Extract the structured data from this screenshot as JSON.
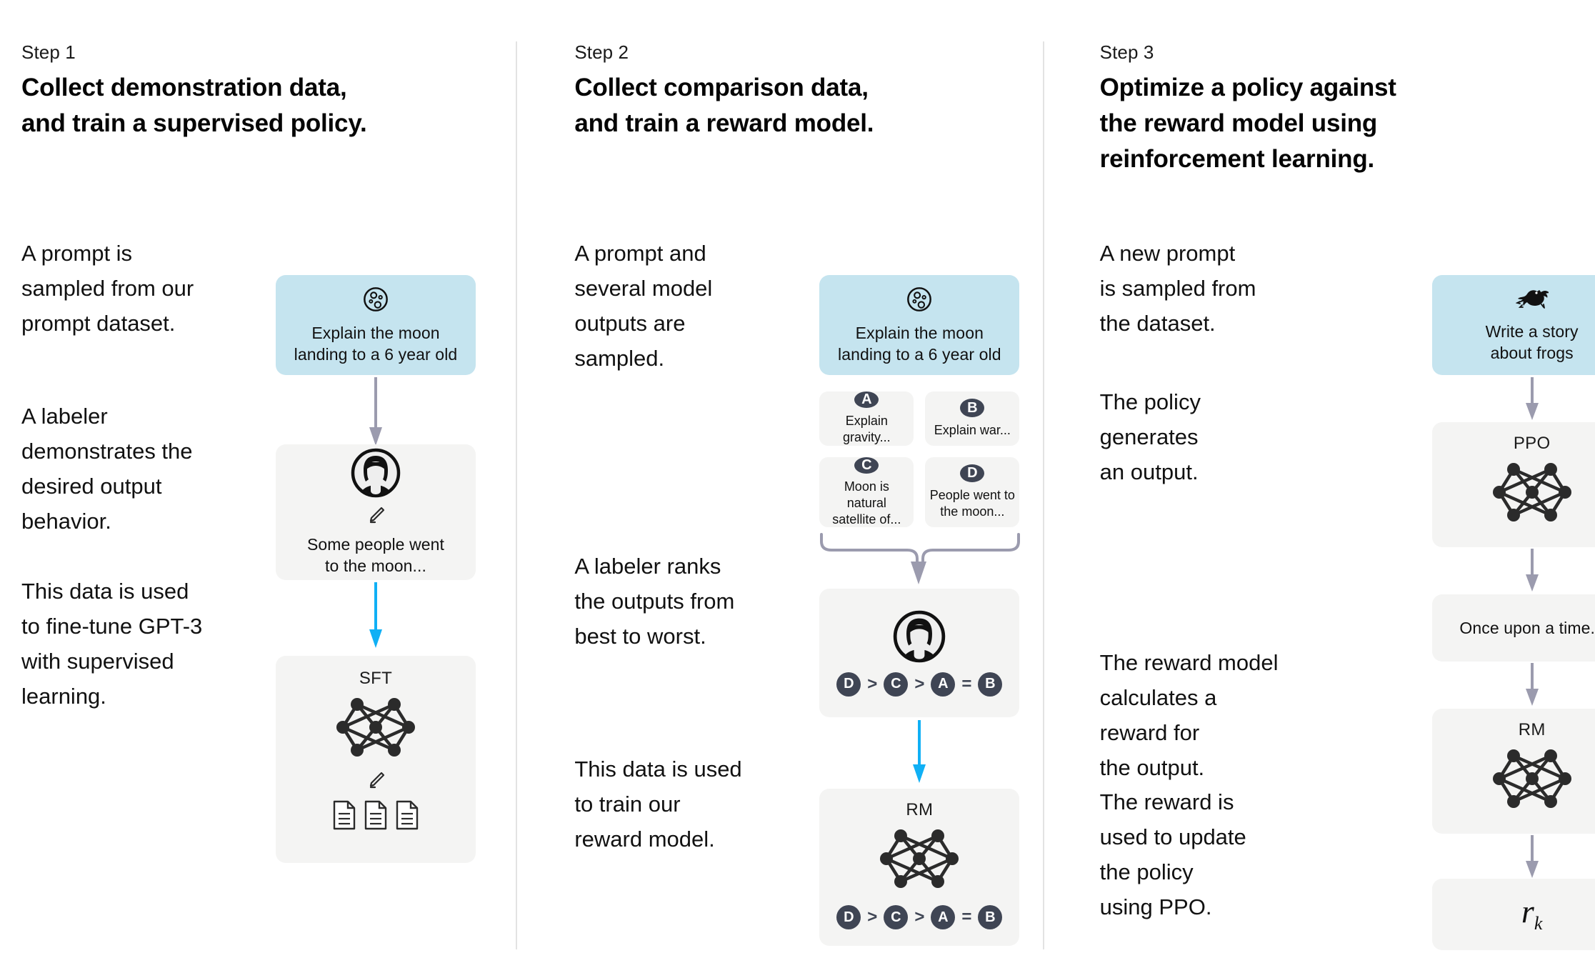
{
  "colors": {
    "prompt_card_bg": "#c5e4ef",
    "neutral_card_bg": "#f4f4f3",
    "arrow_gray": "#9b9bae",
    "arrow_blue": "#10b0f5",
    "badge_bg": "#3f4554",
    "divider": "#e3e3e3",
    "text": "#111111"
  },
  "steps": [
    {
      "label": "Step 1",
      "title": "Collect demonstration data,\nand train a supervised policy.",
      "descriptions": [
        "A prompt is\nsampled from our\nprompt dataset.",
        "A labeler\ndemonstrates the\ndesired output\nbehavior.",
        "This data is used\nto fine-tune GPT-3\nwith supervised\nlearning."
      ],
      "cards": [
        {
          "name": "prompt-card",
          "icon": "moon-icon",
          "text": "Explain the moon\nlanding to a 6 year old"
        },
        {
          "name": "labeler-output-card",
          "icon": "person-icon",
          "sub_icon": "pencil-icon",
          "text": "Some people went\nto the moon..."
        },
        {
          "name": "sft-model-card",
          "title": "SFT",
          "icon": "neural-network-icon",
          "sub_icon": "pencil-icon",
          "extra_icon": "documents-icon"
        }
      ]
    },
    {
      "label": "Step 2",
      "title": "Collect comparison data,\nand train a reward model.",
      "descriptions": [
        "A prompt and\nseveral model\noutputs are\nsampled.",
        "A labeler ranks\nthe outputs from\nbest to worst.",
        "This data is used\nto train our\nreward model."
      ],
      "cards": [
        {
          "name": "prompt-card",
          "icon": "moon-icon",
          "text": "Explain the moon\nlanding to a 6 year old"
        },
        {
          "name": "ranking-card",
          "icon": "person-icon",
          "ranking": [
            "D",
            "C",
            "A",
            "B"
          ],
          "ranking_ops": [
            ">",
            ">",
            "="
          ]
        },
        {
          "name": "reward-model-card",
          "title": "RM",
          "icon": "neural-network-icon",
          "ranking": [
            "D",
            "C",
            "A",
            "B"
          ],
          "ranking_ops": [
            ">",
            ">",
            "="
          ]
        }
      ],
      "outputs": [
        {
          "badge": "A",
          "text": "Explain gravity..."
        },
        {
          "badge": "B",
          "text": "Explain war..."
        },
        {
          "badge": "C",
          "text": "Moon is natural\nsatellite of..."
        },
        {
          "badge": "D",
          "text": "People went to\nthe moon..."
        }
      ]
    },
    {
      "label": "Step 3",
      "title": "Optimize a policy against\nthe reward model using\nreinforcement learning.",
      "descriptions": [
        "A new prompt\nis sampled from\nthe dataset.",
        "The policy\ngenerates\nan output.",
        "The reward model\ncalculates a\nreward for\nthe output.",
        "The reward is\nused to update\nthe policy\nusing PPO."
      ],
      "cards": [
        {
          "name": "prompt-card",
          "icon": "frog-icon",
          "text": "Write a story\nabout frogs"
        },
        {
          "name": "ppo-policy-card",
          "title": "PPO",
          "icon": "neural-network-icon"
        },
        {
          "name": "generated-output-card",
          "text": "Once upon a time..."
        },
        {
          "name": "reward-model-card",
          "title": "RM",
          "icon": "neural-network-icon"
        },
        {
          "name": "reward-value-card",
          "reward_symbol": "r",
          "reward_subscript": "k"
        }
      ]
    }
  ]
}
